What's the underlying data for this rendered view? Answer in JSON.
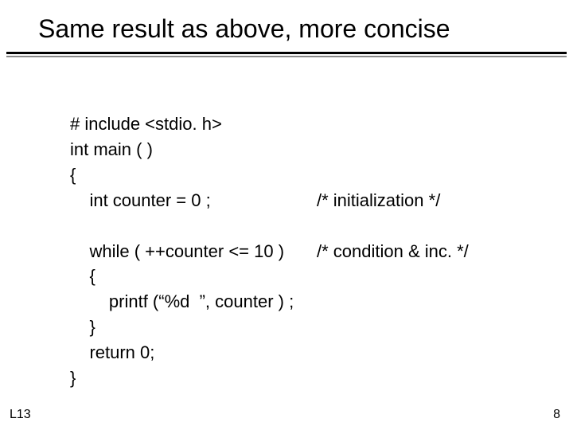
{
  "title": "Same result as above, more concise",
  "code": {
    "l1": "# include <stdio. h>",
    "l2": "int main ( )",
    "l3": "{",
    "l4": "    int counter = 0 ;",
    "c4": "/* initialization */",
    "l5": "    while ( ++counter <= 10 )",
    "c5": "/* condition & inc. */",
    "l6": "    {",
    "l7": "        printf (“%d  ”, counter ) ;",
    "l8": "    }",
    "l9": "    return 0;",
    "l10": "}"
  },
  "footer": {
    "left": "L13",
    "right": "8"
  }
}
